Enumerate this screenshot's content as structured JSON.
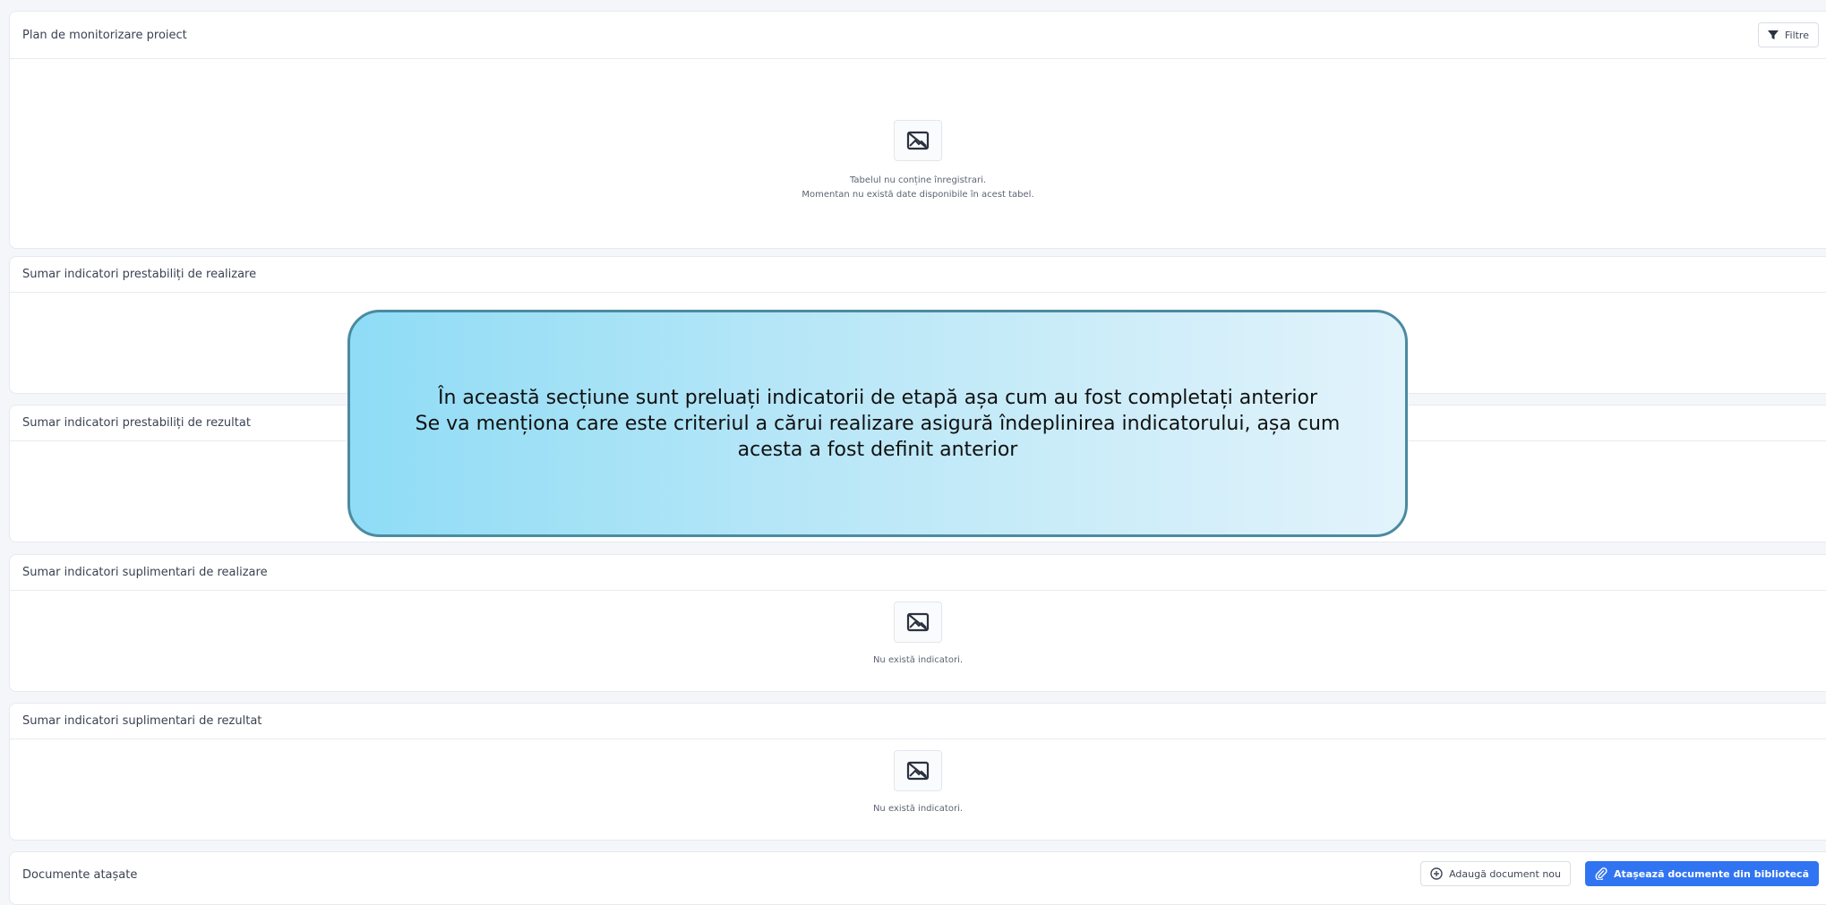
{
  "monitor": {
    "title": "Plan de monitorizare proiect",
    "filter_label": "Filtre",
    "empty_line1": "Tabelul nu conține înregistrari.",
    "empty_line2": "Momentan nu există date disponibile în acest tabel."
  },
  "sections": {
    "predef_realizare": {
      "title": "Sumar indicatori prestabiliți de realizare"
    },
    "predef_rezultat": {
      "title": "Sumar indicatori prestabiliți de rezultat"
    },
    "supl_realizare": {
      "title": "Sumar indicatori suplimentari de realizare",
      "empty": "Nu există indicatori."
    },
    "supl_rezultat": {
      "title": "Sumar indicatori suplimentari de rezultat",
      "empty": "Nu există indicatori."
    }
  },
  "documents": {
    "title": "Documente atașate",
    "add_new_label": "Adaugă document nou",
    "attach_library_label": "Atașează documente din bibliotecă"
  },
  "callout": {
    "line1": "În această secțiune sunt preluați indicatorii de etapă așa cum au fost completați anterior",
    "line2": "Se va menționa care este criteriul a cărui realizare asigură îndeplinirea indicatorului, așa cum acesta a fost definit anterior"
  },
  "icons": {
    "filter": "filter-icon",
    "empty": "no-image-icon",
    "add": "plus-circle-icon",
    "attach": "paperclip-icon"
  },
  "colors": {
    "primary": "#3174f1",
    "callout_border": "#4a8ba0",
    "callout_fill_start": "#8fdcf6",
    "callout_fill_end": "#e2f3fb"
  }
}
